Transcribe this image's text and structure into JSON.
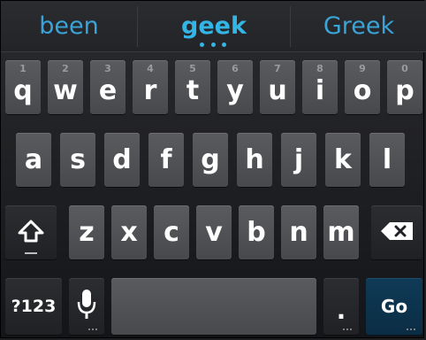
{
  "suggestions": {
    "left": "been",
    "center": "geek",
    "right": "Greek"
  },
  "keyboard": {
    "row1": [
      {
        "letter": "q",
        "hint": "1"
      },
      {
        "letter": "w",
        "hint": "2"
      },
      {
        "letter": "e",
        "hint": "3"
      },
      {
        "letter": "r",
        "hint": "4"
      },
      {
        "letter": "t",
        "hint": "5"
      },
      {
        "letter": "y",
        "hint": "6"
      },
      {
        "letter": "u",
        "hint": "7"
      },
      {
        "letter": "i",
        "hint": "8"
      },
      {
        "letter": "o",
        "hint": "9"
      },
      {
        "letter": "p",
        "hint": "0"
      }
    ],
    "row2": [
      {
        "letter": "a"
      },
      {
        "letter": "s"
      },
      {
        "letter": "d"
      },
      {
        "letter": "f"
      },
      {
        "letter": "g"
      },
      {
        "letter": "h"
      },
      {
        "letter": "j"
      },
      {
        "letter": "k"
      },
      {
        "letter": "l"
      }
    ],
    "row3": [
      {
        "letter": "z"
      },
      {
        "letter": "x"
      },
      {
        "letter": "c"
      },
      {
        "letter": "v"
      },
      {
        "letter": "b"
      },
      {
        "letter": "n"
      },
      {
        "letter": "m"
      }
    ],
    "symbols_label": "?123",
    "period_label": ".",
    "action_label": "Go"
  },
  "icons": {
    "shift": "shift-arrow-icon",
    "backspace": "backspace-icon",
    "microphone": "microphone-icon"
  },
  "colors": {
    "suggestion_text": "#33b5e5",
    "key_face": "#525356",
    "action_key": "#0d3350"
  }
}
